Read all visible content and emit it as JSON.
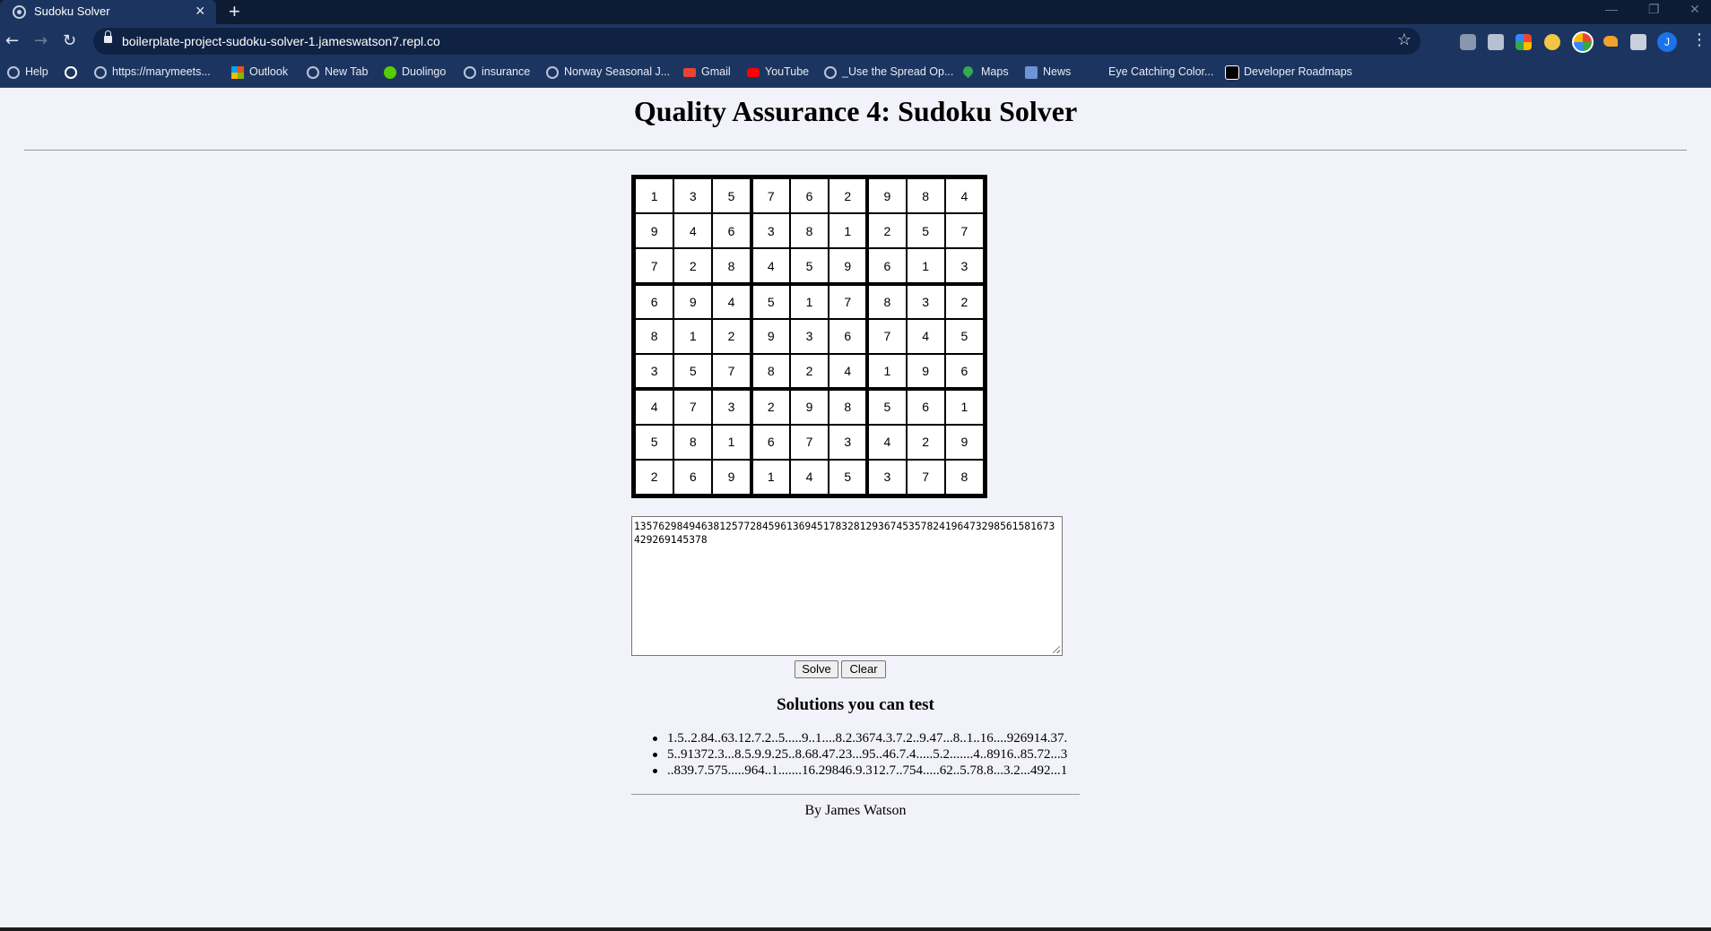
{
  "browser": {
    "tab_title": "Sudoku Solver",
    "url": "boilerplate-project-sudoku-solver-1.jameswatson7.repl.co",
    "bookmarks": [
      {
        "label": "Help",
        "icon": "help-icon"
      },
      {
        "label": "",
        "icon": "google-icon"
      },
      {
        "label": "https://marymeets...",
        "icon": "globe-icon"
      },
      {
        "label": "Outlook",
        "icon": "microsoft-icon"
      },
      {
        "label": "New Tab",
        "icon": "globe-icon"
      },
      {
        "label": "Duolingo",
        "icon": "duolingo-icon"
      },
      {
        "label": "insurance",
        "icon": "globe-icon"
      },
      {
        "label": "Norway Seasonal J...",
        "icon": "globe-icon"
      },
      {
        "label": "Gmail",
        "icon": "gmail-icon"
      },
      {
        "label": "YouTube",
        "icon": "youtube-icon"
      },
      {
        "label": "_Use the Spread Op...",
        "icon": "globe-icon"
      },
      {
        "label": "Maps",
        "icon": "maps-icon"
      },
      {
        "label": "News",
        "icon": "news-icon"
      },
      {
        "label": "Eye Catching Color...",
        "icon": ""
      },
      {
        "label": "Developer Roadmaps",
        "icon": "roadmap-icon"
      }
    ],
    "profile_initial": "J"
  },
  "page": {
    "title": "Quality Assurance 4: Sudoku Solver",
    "grid": [
      [
        "1",
        "3",
        "5",
        "7",
        "6",
        "2",
        "9",
        "8",
        "4"
      ],
      [
        "9",
        "4",
        "6",
        "3",
        "8",
        "1",
        "2",
        "5",
        "7"
      ],
      [
        "7",
        "2",
        "8",
        "4",
        "5",
        "9",
        "6",
        "1",
        "3"
      ],
      [
        "6",
        "9",
        "4",
        "5",
        "1",
        "7",
        "8",
        "3",
        "2"
      ],
      [
        "8",
        "1",
        "2",
        "9",
        "3",
        "6",
        "7",
        "4",
        "5"
      ],
      [
        "3",
        "5",
        "7",
        "8",
        "2",
        "4",
        "1",
        "9",
        "6"
      ],
      [
        "4",
        "7",
        "3",
        "2",
        "9",
        "8",
        "5",
        "6",
        "1"
      ],
      [
        "5",
        "8",
        "1",
        "6",
        "7",
        "3",
        "4",
        "2",
        "9"
      ],
      [
        "2",
        "6",
        "9",
        "1",
        "4",
        "5",
        "3",
        "7",
        "8"
      ]
    ],
    "textarea_value": "135762984946381257728459613694517832812936745357824196473298561581673429269145378",
    "solve_label": "Solve",
    "clear_label": "Clear",
    "solutions_heading": "Solutions you can test",
    "solutions": [
      "1.5..2.84..63.12.7.2..5.....9..1....8.2.3674.3.7.2..9.47...8..1..16....926914.37.",
      "5..91372.3...8.5.9.9.25..8.68.47.23...95..46.7.4.....5.2.......4..8916..85.72...3",
      "..839.7.575.....964..1.......16.29846.9.312.7..754.....62..5.78.8...3.2...492...1"
    ],
    "footer": "By James Watson"
  },
  "colors": {
    "chrome_dark": "#0d1b33",
    "chrome": "#1c3560",
    "page_bg": "#f2f2fb"
  }
}
